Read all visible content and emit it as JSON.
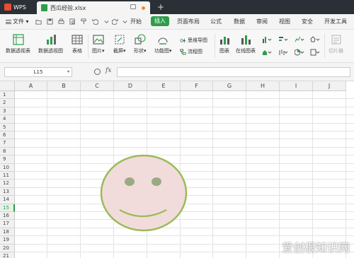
{
  "titlebar": {
    "app_name": "WPS",
    "document_tab": "西瓜经验.xlsx",
    "add_tab_symbol": "+"
  },
  "menubar": {
    "file_label": "文件",
    "tabs": [
      "开始",
      "插入",
      "页面布局",
      "公式",
      "数据",
      "审阅",
      "视图",
      "安全",
      "开发工具"
    ],
    "active_tab": "插入"
  },
  "ribbon": {
    "pivot_table": "数据透视表",
    "pivot_chart": "数据透视图",
    "table": "表格",
    "picture": "图片",
    "screenshot": "截屏",
    "shapes": "形状",
    "smartart": "功能图",
    "mindmap": "思维导图",
    "flowchart": "流程图",
    "chart": "图表",
    "online_chart": "在线图表",
    "slicer": "切片器"
  },
  "formula_bar": {
    "name_box": "L15",
    "fx_label": "fx",
    "formula_value": ""
  },
  "sheet": {
    "columns": [
      "A",
      "B",
      "C",
      "D",
      "E",
      "F",
      "G",
      "H",
      "I",
      "J"
    ],
    "rows": [
      "1",
      "2",
      "3",
      "4",
      "5",
      "6",
      "7",
      "8",
      "9",
      "10",
      "11",
      "12",
      "13",
      "14",
      "15",
      "16",
      "17",
      "18",
      "19",
      "20",
      "21"
    ],
    "active_row": "15"
  },
  "drawing": {
    "shape": "smiley-face",
    "fill_color": "#f2dcdb",
    "outline_color": "#9bbb59",
    "feature_color": "#9aaa82",
    "mouth_color": "#9bbb59"
  },
  "watermark": "爱创根知识网",
  "colors": {
    "accent": "#2e9d4a",
    "titlebar_bg": "#2b2f36"
  }
}
